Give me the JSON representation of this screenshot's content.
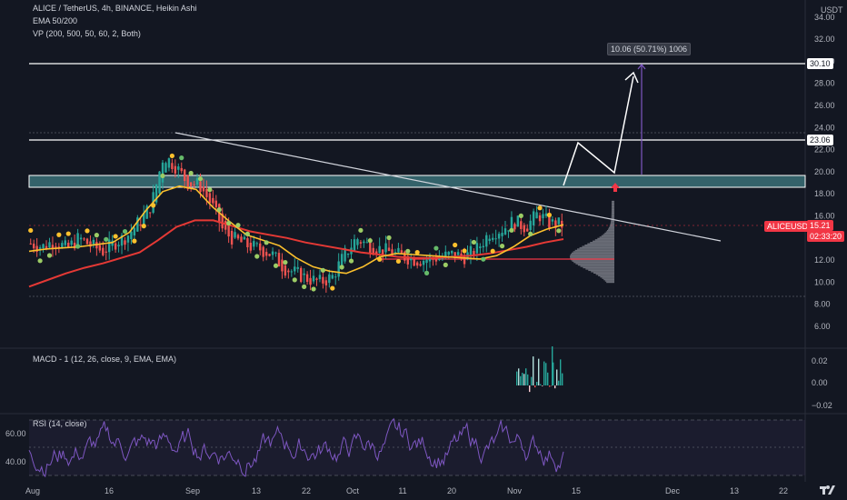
{
  "header": {
    "title": "ALICE / TetherUS, 4h, BINANCE, Heikin Ashi",
    "ema_legend": "EMA 50/200",
    "vp_legend": "VP (200, 500, 50, 60, 2, Both)",
    "currency": "USDT"
  },
  "price_axis": {
    "ticks": [
      "34.00",
      "32.00",
      "30.00",
      "28.00",
      "26.00",
      "24.00",
      "22.00",
      "20.00",
      "18.00",
      "16.00",
      "14.00",
      "12.00",
      "10.00",
      "8.00",
      "6.00"
    ],
    "badge_30_10": "30.10",
    "badge_23_06": "23.06",
    "symbol_badge": "ALICEUSDT",
    "last_price": "15.21",
    "countdown": "02:33:20"
  },
  "annotation": {
    "target_box": "10.06 (50.71%) 1006"
  },
  "macd": {
    "legend": "MACD - 1 (12, 26, close, 9, EMA, EMA)",
    "ticks": [
      "0.02",
      "0.00",
      "−0.02"
    ]
  },
  "rsi": {
    "legend": "RSI (14, close)",
    "ticks": [
      "60.00",
      "40.00"
    ]
  },
  "time_axis": {
    "labels": [
      "Aug",
      "16",
      "Sep",
      "13",
      "22",
      "Oct",
      "11",
      "20",
      "Nov",
      "15",
      "Dec",
      "13",
      "22"
    ]
  },
  "chart_data": {
    "type": "candlestick",
    "symbol": "ALICE / TetherUS",
    "interval": "4h",
    "exchange": "BINANCE",
    "style": "Heikin Ashi",
    "y_range": [
      6,
      34
    ],
    "levels": [
      30.1,
      23.06,
      19.7,
      18.7,
      8.7
    ],
    "support_zone": [
      18.7,
      19.7
    ],
    "trendline": {
      "start": 23.8,
      "end": 14.1
    },
    "last_price": 15.21,
    "projection": [
      18.9,
      21.3,
      20.2,
      28.9
    ],
    "approx_close_path": [
      13.5,
      13.2,
      13.8,
      13.0,
      14.0,
      13.3,
      12.8,
      13.6,
      14.2,
      15.5,
      17.0,
      21.5,
      20.5,
      19.0,
      18.8,
      17.0,
      14.5,
      13.8,
      13.3,
      13.0,
      12.5,
      11.3,
      10.8,
      10.3,
      10.0,
      10.5,
      12.5,
      14.0,
      13.3,
      13.0,
      12.6,
      12.3,
      12.0,
      12.1,
      12.3,
      12.5,
      12.3,
      13.0,
      14.5,
      14.8,
      15.5,
      15.0,
      16.2,
      15.3,
      15.2
    ],
    "ema_50": [
      12.8,
      13.0,
      13.1,
      13.2,
      13.4,
      13.6,
      14.5,
      16.5,
      18.2,
      18.7,
      18.4,
      16.8,
      15.5,
      14.3,
      13.8,
      13.3,
      12.2,
      11.4,
      11.0,
      10.8,
      11.4,
      12.3,
      12.6,
      12.5,
      12.4,
      12.3,
      12.2,
      12.1,
      12.4,
      13.2,
      14.2,
      14.8,
      15.2
    ],
    "ema_200": [
      9.6,
      10.2,
      10.8,
      11.3,
      11.7,
      12.2,
      12.7,
      13.8,
      15.0,
      15.6,
      15.6,
      15.1,
      14.6,
      14.3,
      14.0,
      13.6,
      13.3,
      13.0,
      12.7,
      12.5,
      12.3,
      12.2,
      12.2,
      12.3,
      12.4,
      12.6,
      12.9,
      13.2,
      13.6
    ]
  }
}
